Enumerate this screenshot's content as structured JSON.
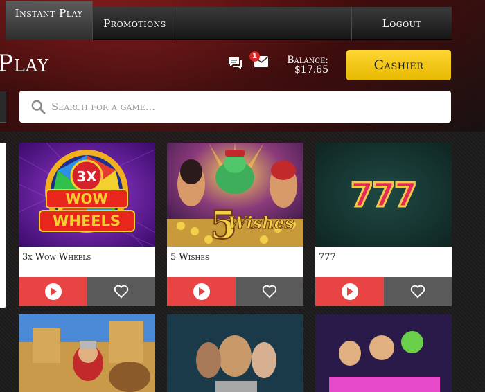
{
  "nav": {
    "items": [
      {
        "label": "Instant Play",
        "active": true
      },
      {
        "label": "Promotions",
        "active": false
      },
      {
        "label": "Logout",
        "active": false
      }
    ]
  },
  "header": {
    "title": "Play",
    "notification_count": "1",
    "balance_label": "Balance:",
    "balance_value": "$17.65",
    "cashier_label": "Cashier"
  },
  "search": {
    "placeholder": "Search for a game..."
  },
  "games": [
    {
      "name": "3x Wow Wheels"
    },
    {
      "name": "5 Wishes"
    },
    {
      "name": "777"
    }
  ],
  "colors": {
    "accent": "#e84444",
    "cashier": "#ffd633",
    "badge": "#d72626"
  }
}
